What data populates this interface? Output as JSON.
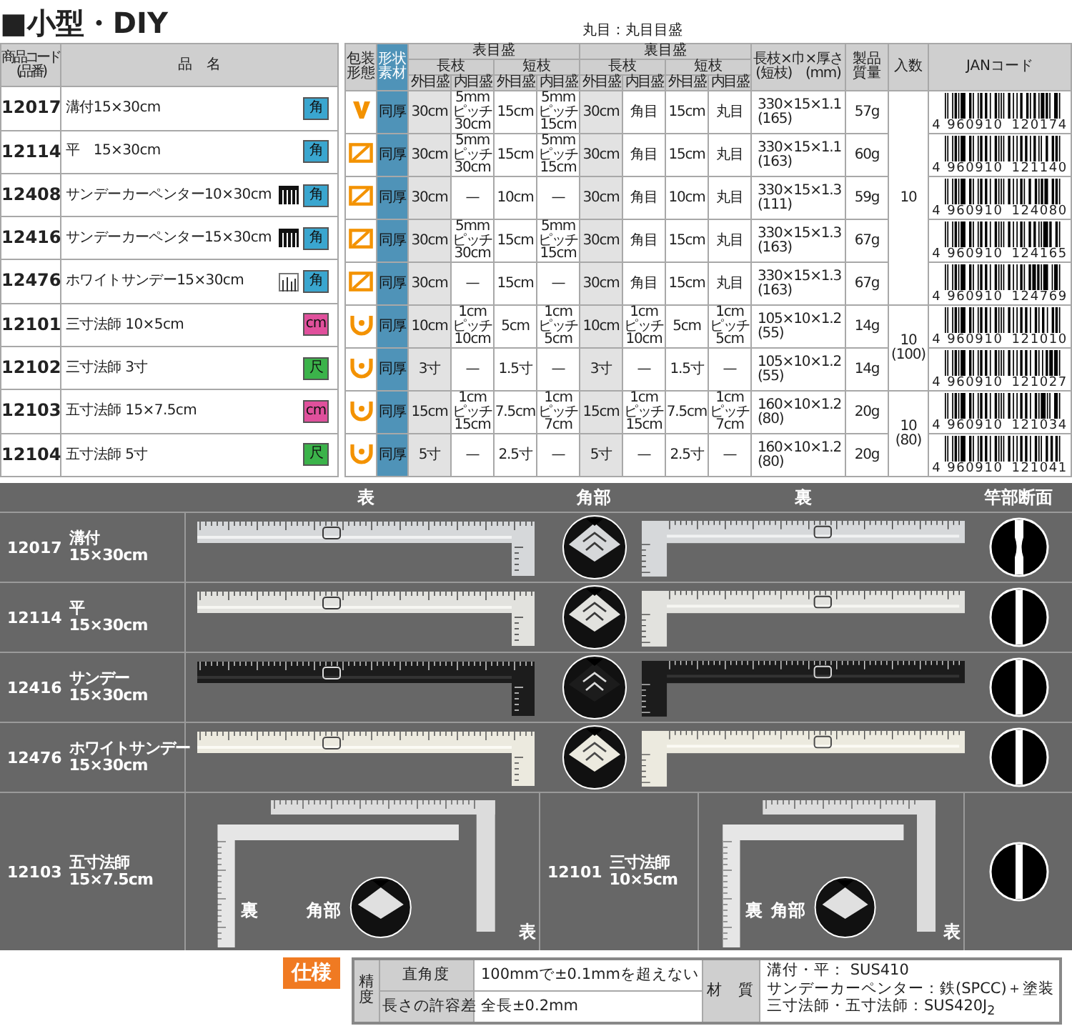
{
  "title": "■小型・DIY",
  "note": "丸目：丸目目盛",
  "product_table": {
    "columns": [
      "商品コード\n(品番)",
      "品　名"
    ],
    "rows": [
      {
        "code": "12017",
        "name": "溝付15×30cm",
        "kind": "plain",
        "badge": {
          "text": "角",
          "color": "#3aa6cf"
        }
      },
      {
        "code": "12114",
        "name": "平　15×30cm",
        "kind": "plain",
        "badge": {
          "text": "角",
          "color": "#3aa6cf"
        }
      },
      {
        "code": "12408",
        "name": "サンデーカーペンター10×30cm",
        "kind": "dark-scale",
        "badge": {
          "text": "角",
          "color": "#3aa6cf"
        }
      },
      {
        "code": "12416",
        "name": "サンデーカーペンター15×30cm",
        "kind": "dark-scale",
        "badge": {
          "text": "角",
          "color": "#3aa6cf"
        }
      },
      {
        "code": "12476",
        "name": "ホワイトサンデー15×30cm",
        "kind": "light-scale",
        "badge": {
          "text": "角",
          "color": "#3aa6cf"
        }
      },
      {
        "code": "12101",
        "name": "三寸法師 10×5cm",
        "kind": "plain",
        "badge": {
          "text": "cm",
          "color": "#e0509c"
        }
      },
      {
        "code": "12102",
        "name": "三寸法師 3寸",
        "kind": "plain",
        "badge": {
          "text": "尺",
          "color": "#3bb34a"
        }
      },
      {
        "code": "12103",
        "name": "五寸法師 15×7.5cm",
        "kind": "plain",
        "badge": {
          "text": "cm",
          "color": "#e0509c"
        }
      },
      {
        "code": "12104",
        "name": "五寸法師 5寸",
        "kind": "plain",
        "badge": {
          "text": "尺",
          "color": "#3bb34a"
        }
      }
    ]
  },
  "spec_table": {
    "header": {
      "packaging": "包装形態",
      "shape": "形状素材",
      "front": "表目盛",
      "back": "裏目盛",
      "size": "長枝×巾×厚さ\n(短枝)　(mm)",
      "weight": "製品質量",
      "quantity": "入数",
      "jan": "JANコード"
    },
    "branch_headers": [
      "長枝",
      "短枝",
      "長枝",
      "短枝"
    ],
    "scale_headers": [
      "外目盛",
      "内目盛",
      "外目盛",
      "内目盛",
      "外目盛",
      "内目盛",
      "外目盛",
      "内目盛"
    ],
    "groups": [
      {
        "quantity": "10",
        "rows": [
          {
            "kind": "hook",
            "shape": "同厚",
            "front": [
              "30cm",
              "5mm\nピッチ\n30cm",
              "15cm",
              "5mm\nピッチ\n15cm"
            ],
            "back": [
              "30cm",
              "角目",
              "15cm",
              "丸目"
            ],
            "size": "330×15×1.1\n(165)",
            "weight": "57g",
            "jan": [
              "4",
              "960910",
              "120174"
            ]
          },
          {
            "kind": "case",
            "shape": "同厚",
            "front": [
              "30cm",
              "5mm\nピッチ\n30cm",
              "15cm",
              "5mm\nピッチ\n15cm"
            ],
            "back": [
              "30cm",
              "角目",
              "15cm",
              "丸目"
            ],
            "size": "330×15×1.1\n(163)",
            "weight": "60g",
            "jan": [
              "4",
              "960910",
              "121140"
            ]
          },
          {
            "kind": "case",
            "shape": "同厚",
            "front": [
              "30cm",
              "—",
              "10cm",
              "—"
            ],
            "back": [
              "30cm",
              "角目",
              "10cm",
              "丸目"
            ],
            "size": "330×15×1.3\n(111)",
            "weight": "59g",
            "jan": [
              "4",
              "960910",
              "124080"
            ]
          },
          {
            "kind": "case",
            "shape": "同厚",
            "front": [
              "30cm",
              "5mm\nピッチ\n30cm",
              "15cm",
              "5mm\nピッチ\n15cm"
            ],
            "back": [
              "30cm",
              "角目",
              "15cm",
              "丸目"
            ],
            "size": "330×15×1.3\n(163)",
            "weight": "67g",
            "jan": [
              "4",
              "960910",
              "124165"
            ]
          },
          {
            "kind": "case",
            "shape": "同厚",
            "front": [
              "30cm",
              "—",
              "15cm",
              "—"
            ],
            "back": [
              "30cm",
              "角目",
              "15cm",
              "丸目"
            ],
            "size": "330×15×1.3\n(163)",
            "weight": "67g",
            "jan": [
              "4",
              "960910",
              "124769"
            ]
          }
        ]
      },
      {
        "quantity": "10\n(100)",
        "rows": [
          {
            "kind": "cup",
            "shape": "同厚",
            "front": [
              "10cm",
              "1cm\nピッチ\n10cm",
              "5cm",
              "1cm\nピッチ\n5cm"
            ],
            "back": [
              "10cm",
              "1cm\nピッチ\n10cm",
              "5cm",
              "1cm\nピッチ\n5cm"
            ],
            "size": "105×10×1.2\n(55)",
            "weight": "14g",
            "jan": [
              "4",
              "960910",
              "121010"
            ]
          },
          {
            "kind": "cup",
            "shape": "同厚",
            "front": [
              "3寸",
              "—",
              "1.5寸",
              "—"
            ],
            "back": [
              "3寸",
              "—",
              "1.5寸",
              "—"
            ],
            "size": "105×10×1.2\n(55)",
            "weight": "14g",
            "jan": [
              "4",
              "960910",
              "121027"
            ]
          }
        ]
      },
      {
        "quantity": "10\n(80)",
        "rows": [
          {
            "kind": "cup",
            "shape": "同厚",
            "front": [
              "15cm",
              "1cm\nピッチ\n15cm",
              "7.5cm",
              "1cm\nピッチ\n7cm"
            ],
            "back": [
              "15cm",
              "1cm\nピッチ\n15cm",
              "7.5cm",
              "1cm\nピッチ\n7cm"
            ],
            "size": "160×10×1.2\n(80)",
            "weight": "20g",
            "jan": [
              "4",
              "960910",
              "121034"
            ]
          },
          {
            "kind": "cup",
            "shape": "同厚",
            "front": [
              "5寸",
              "—",
              "2.5寸",
              "—"
            ],
            "back": [
              "5寸",
              "—",
              "2.5寸",
              "—"
            ],
            "size": "160×10×1.2\n(80)",
            "weight": "20g",
            "jan": [
              "4",
              "960910",
              "121041"
            ]
          }
        ]
      }
    ]
  },
  "photo_table": {
    "headers": [
      "表",
      "角部",
      "裏",
      "竿部断面"
    ],
    "rows": [
      {
        "code": "12017",
        "name": "溝付\n15×30cm",
        "kind": "grooved"
      },
      {
        "code": "12114",
        "name": "平\n15×30cm",
        "kind": "flat"
      },
      {
        "code": "12416",
        "name": "サンデー\n15×30cm",
        "kind": "flat"
      },
      {
        "code": "12476",
        "name": "ホワイトサンデー\n15×30cm",
        "kind": "flat"
      }
    ],
    "pair_row": {
      "items": [
        {
          "code": "12103",
          "name": "五寸法師\n15×7.5cm",
          "labels": [
            "裏",
            "角部",
            "表"
          ]
        },
        {
          "code": "12101",
          "name": "三寸法師\n10×5cm",
          "labels": [
            "裏",
            "角部",
            "表"
          ]
        }
      ],
      "kind": "flat"
    }
  },
  "specs": {
    "label": "仕様",
    "group": "精度",
    "rows": [
      {
        "name": "直角度",
        "value": "100mmで±0.1mmを超えない"
      },
      {
        "name": "長さの許容差",
        "value": "全長±0.2mm"
      }
    ],
    "material_label": "材　質",
    "materials": [
      "溝付・平：  SUS410",
      "サンデーカーペンター：鉄(SPCC)＋塗装",
      "三寸法師・五寸法師：SUS420J$_{2}$"
    ]
  }
}
